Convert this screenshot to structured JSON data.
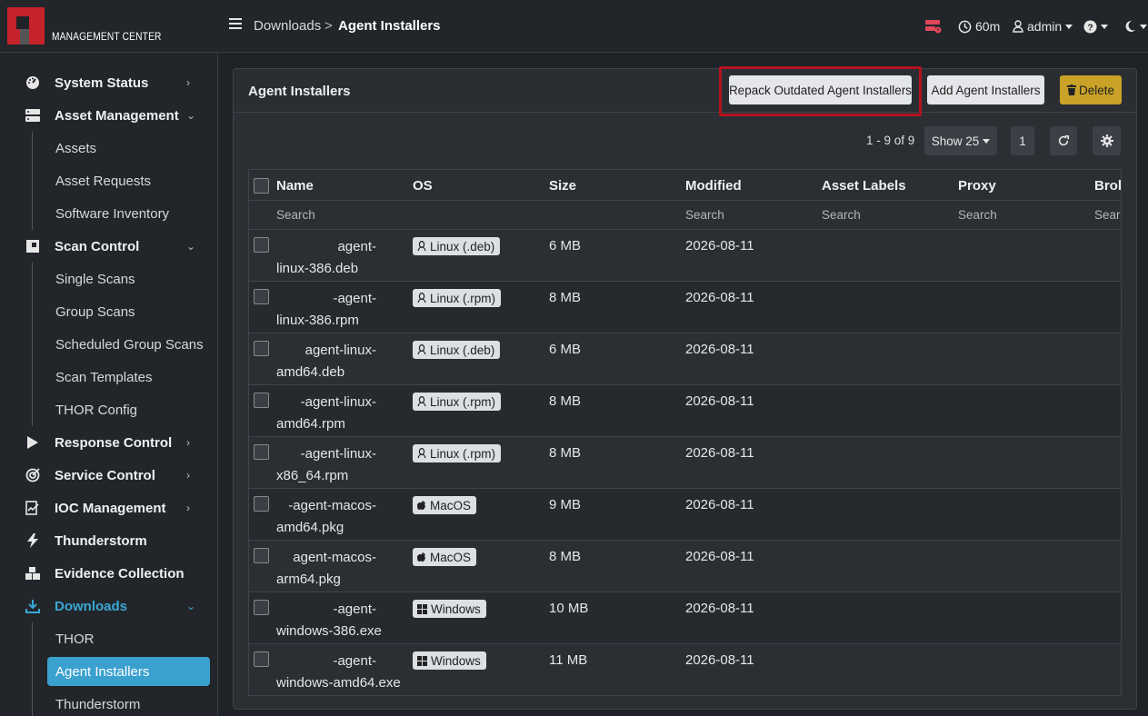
{
  "brand": "MANAGEMENT CENTER",
  "breadcrumb": {
    "parent": "Downloads",
    "separator": ">",
    "current": "Agent Installers"
  },
  "topbar": {
    "timeout": "60m",
    "user": "admin"
  },
  "sidebar": {
    "items": [
      {
        "label": "System Status",
        "icon": "dashboard-icon"
      },
      {
        "label": "Asset Management",
        "icon": "server-icon"
      },
      {
        "label": "Scan Control",
        "icon": "scan-icon"
      },
      {
        "label": "Response Control",
        "icon": "play-icon"
      },
      {
        "label": "Service Control",
        "icon": "target-icon"
      },
      {
        "label": "IOC Management",
        "icon": "ioc-icon"
      },
      {
        "label": "Thunderstorm",
        "icon": "bolt-icon"
      },
      {
        "label": "Evidence Collection",
        "icon": "boxes-icon"
      },
      {
        "label": "Downloads",
        "icon": "download-icon"
      }
    ],
    "asset_sub": [
      "Assets",
      "Asset Requests",
      "Software Inventory"
    ],
    "scan_sub": [
      "Single Scans",
      "Group Scans",
      "Scheduled Group Scans",
      "Scan Templates",
      "THOR Config"
    ],
    "downloads_sub": [
      "THOR",
      "Agent Installers",
      "Thunderstorm"
    ]
  },
  "card": {
    "title": "Agent Installers",
    "repack_label": "Repack Outdated Agent Installers",
    "add_label": "Add Agent Installers",
    "delete_label": "Delete"
  },
  "pager": {
    "range": "1 - 9 of 9",
    "show": "Show 25",
    "page": "1"
  },
  "table": {
    "columns": [
      "Name",
      "OS",
      "Size",
      "Modified",
      "Asset Labels",
      "Proxy",
      "Brok"
    ],
    "filter_placeholder": "Search",
    "rows": [
      {
        "name1": "agent-",
        "name2": "linux-386.deb",
        "os": "Linux (.deb)",
        "os_icon": "linux-icon",
        "size": "6 MB",
        "modified": "2026-08-11"
      },
      {
        "name1": "-agent-",
        "name2": "linux-386.rpm",
        "os": "Linux (.rpm)",
        "os_icon": "linux-icon",
        "size": "8 MB",
        "modified": "2026-08-11"
      },
      {
        "name1": "agent-linux-",
        "name2": "amd64.deb",
        "os": "Linux (.deb)",
        "os_icon": "linux-icon",
        "size": "6 MB",
        "modified": "2026-08-11"
      },
      {
        "name1": "-agent-linux-",
        "name2": "amd64.rpm",
        "os": "Linux (.rpm)",
        "os_icon": "linux-icon",
        "size": "8 MB",
        "modified": "2026-08-11"
      },
      {
        "name1": "-agent-linux-",
        "name2": "x86_64.rpm",
        "os": "Linux (.rpm)",
        "os_icon": "linux-icon",
        "size": "8 MB",
        "modified": "2026-08-11"
      },
      {
        "name1": "-agent-macos-",
        "name2": "amd64.pkg",
        "os": "MacOS",
        "os_icon": "apple-icon",
        "size": "9 MB",
        "modified": "2026-08-11"
      },
      {
        "name1": "agent-macos-",
        "name2": "arm64.pkg",
        "os": "MacOS",
        "os_icon": "apple-icon",
        "size": "8 MB",
        "modified": "2026-08-11"
      },
      {
        "name1": "-agent-",
        "name2": "windows-386.exe",
        "os": "Windows",
        "os_icon": "windows-icon",
        "size": "10 MB",
        "modified": "2026-08-11"
      },
      {
        "name1": "-agent-",
        "name2": "windows-amd64.exe",
        "os": "Windows",
        "os_icon": "windows-icon",
        "size": "11 MB",
        "modified": "2026-08-11"
      }
    ]
  }
}
